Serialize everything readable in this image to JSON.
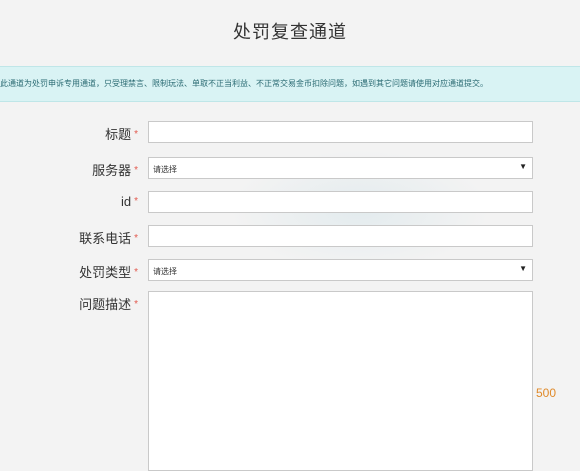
{
  "page": {
    "title": "处罚复查通道"
  },
  "notice": {
    "text": "此通道为处罚申诉专用通道，只受理禁言、限制玩法、单取不正当利益、不正常交易金币扣除问题，如遇到其它问题请使用对应通道提交。"
  },
  "form": {
    "required_mark": "*",
    "title_label": "标题",
    "title_value": "",
    "server_label": "服务器",
    "server_value": "请选择",
    "id_label": "id",
    "id_value": "",
    "phone_label": "联系电话",
    "phone_value": "",
    "penalty_type_label": "处罚类型",
    "penalty_type_value": "请选择",
    "description_label": "问题描述",
    "description_value": "",
    "char_limit": "500"
  },
  "icons": {
    "select_arrow": "caret-down-icon"
  }
}
